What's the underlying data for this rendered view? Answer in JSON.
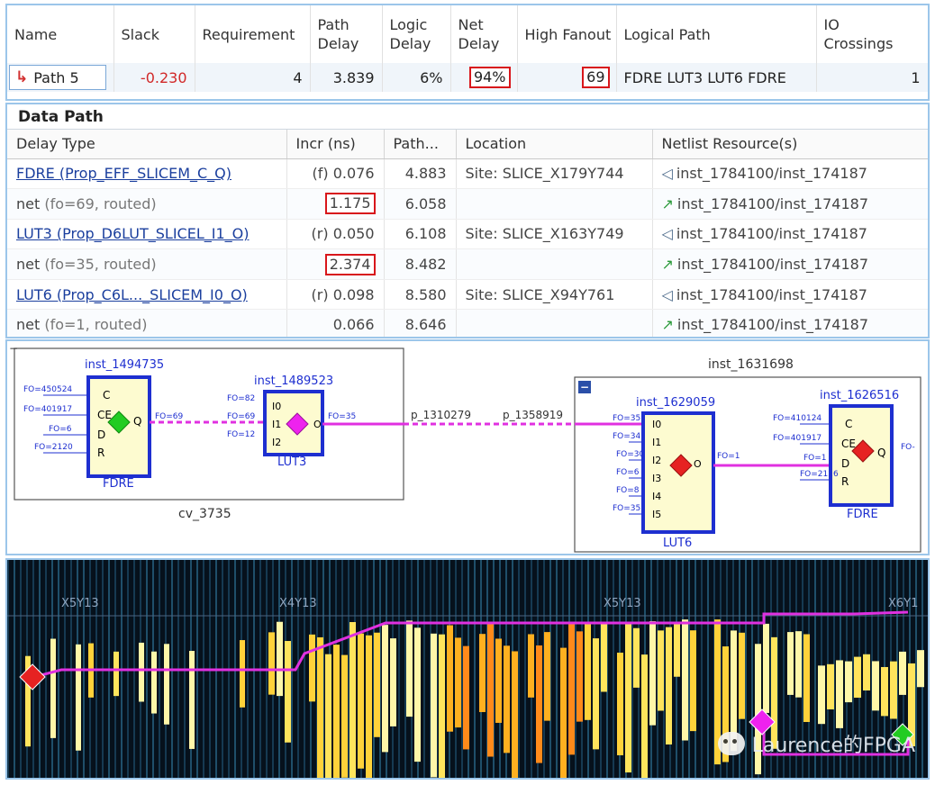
{
  "timing": {
    "headers": {
      "name": "Name",
      "slack": "Slack",
      "requirement": "Requirement",
      "path_delay_1": "Path",
      "path_delay_2": "Delay",
      "logic_delay_1": "Logic",
      "logic_delay_2": "Delay",
      "net_delay_1": "Net",
      "net_delay_2": "Delay",
      "high_fanout": "High Fanout",
      "logical_path": "Logical Path",
      "io_crossings_1": "IO",
      "io_crossings_2": "Crossings"
    },
    "row": {
      "name": "Path 5",
      "slack": "-0.230",
      "requirement": "4",
      "path_delay": "3.839",
      "logic_delay": "6%",
      "net_delay": "94%",
      "high_fanout": "69",
      "logical_path": "FDRE LUT3 LUT6 FDRE",
      "io_crossings": "1"
    }
  },
  "data_path": {
    "title": "Data Path",
    "headers": {
      "delay_type": "Delay Type",
      "incr": "Incr (ns)",
      "path": "Path...",
      "location": "Location",
      "netlist": "Netlist Resource(s)"
    },
    "rows": [
      {
        "delay_type": "FDRE (Prop_EFF_SLICEM_C_Q)",
        "tag": "(f)",
        "incr": "0.076",
        "path": "4.883",
        "location": "Site: SLICE_X179Y744",
        "netlist": "inst_1784100/inst_174187"
      },
      {
        "delay_type": "net",
        "detail": "(fo=69, routed)",
        "incr": "1.175",
        "path": "6.058",
        "location": "",
        "netlist": "inst_1784100/inst_174187"
      },
      {
        "delay_type": "LUT3 (Prop_D6LUT_SLICEL_I1_O)",
        "tag": "(r)",
        "incr": "0.050",
        "path": "6.108",
        "location": "Site: SLICE_X163Y749",
        "netlist": "inst_1784100/inst_174187"
      },
      {
        "delay_type": "net",
        "detail": "(fo=35, routed)",
        "incr": "2.374",
        "path": "8.482",
        "location": "",
        "netlist": "inst_1784100/inst_174187"
      },
      {
        "delay_type": "LUT6 (Prop_C6L..._SLICEM_I0_O)",
        "tag": "(r)",
        "incr": "0.098",
        "path": "8.580",
        "location": "Site: SLICE_X94Y761",
        "netlist": "inst_1784100/inst_174187"
      },
      {
        "delay_type": "net",
        "detail": "(fo=1, routed)",
        "incr": "0.066",
        "path": "8.646",
        "location": "",
        "netlist": "inst_1784100/inst_174187"
      }
    ]
  },
  "schematic": {
    "group_left": "cv_3735",
    "group_right": "inst_1631698",
    "collapse_symbol": "−",
    "cells": {
      "fdre1": {
        "inst": "inst_1494735",
        "type": "FDRE",
        "pins": [
          "C",
          "CE",
          "D",
          "R"
        ],
        "out": "Q"
      },
      "lut3": {
        "inst": "inst_1489523",
        "type": "LUT3",
        "pins": [
          "I0",
          "I1",
          "I2"
        ],
        "out": "O"
      },
      "lut6": {
        "inst": "inst_1629059",
        "type": "LUT6",
        "pins": [
          "I0",
          "I1",
          "I2",
          "I3",
          "I4",
          "I5"
        ],
        "out": "O"
      },
      "fdre2": {
        "inst": "inst_1626516",
        "type": "FDRE",
        "pins": [
          "C",
          "CE",
          "D",
          "R"
        ],
        "out": "Q"
      }
    },
    "fo_labels": {
      "fdre1_in": [
        "FO=450524",
        "FO=401917",
        "FO=6",
        "FO=2120"
      ],
      "fdre1_out": "FO=69",
      "lut3_in": [
        "FO=82",
        "FO=69",
        "FO=12"
      ],
      "lut3_out": "FO=35",
      "lut6_in": [
        "FO=35",
        "FO=34",
        "FO=30",
        "FO=6",
        "FO=8",
        "FO=35"
      ],
      "lut6_out": "FO=1",
      "fdre2_in": [
        "FO=410124",
        "FO=401917",
        "FO=1",
        "FO=2126"
      ],
      "fdre2_out": "FO-"
    },
    "ports": [
      "p_1310279",
      "p_1358919"
    ]
  },
  "device_view": {
    "regions": [
      "X5Y13",
      "X4Y13",
      "X5Y13",
      "X6Y1"
    ],
    "watermark": "Laurence的FPGA"
  },
  "colors": {
    "highlight": "#d8161b",
    "net_path": "#e030e0",
    "cell_border": "#1e2fd0",
    "cell_fill": "#fdfbd0",
    "panel_border": "#9cc6ea"
  }
}
